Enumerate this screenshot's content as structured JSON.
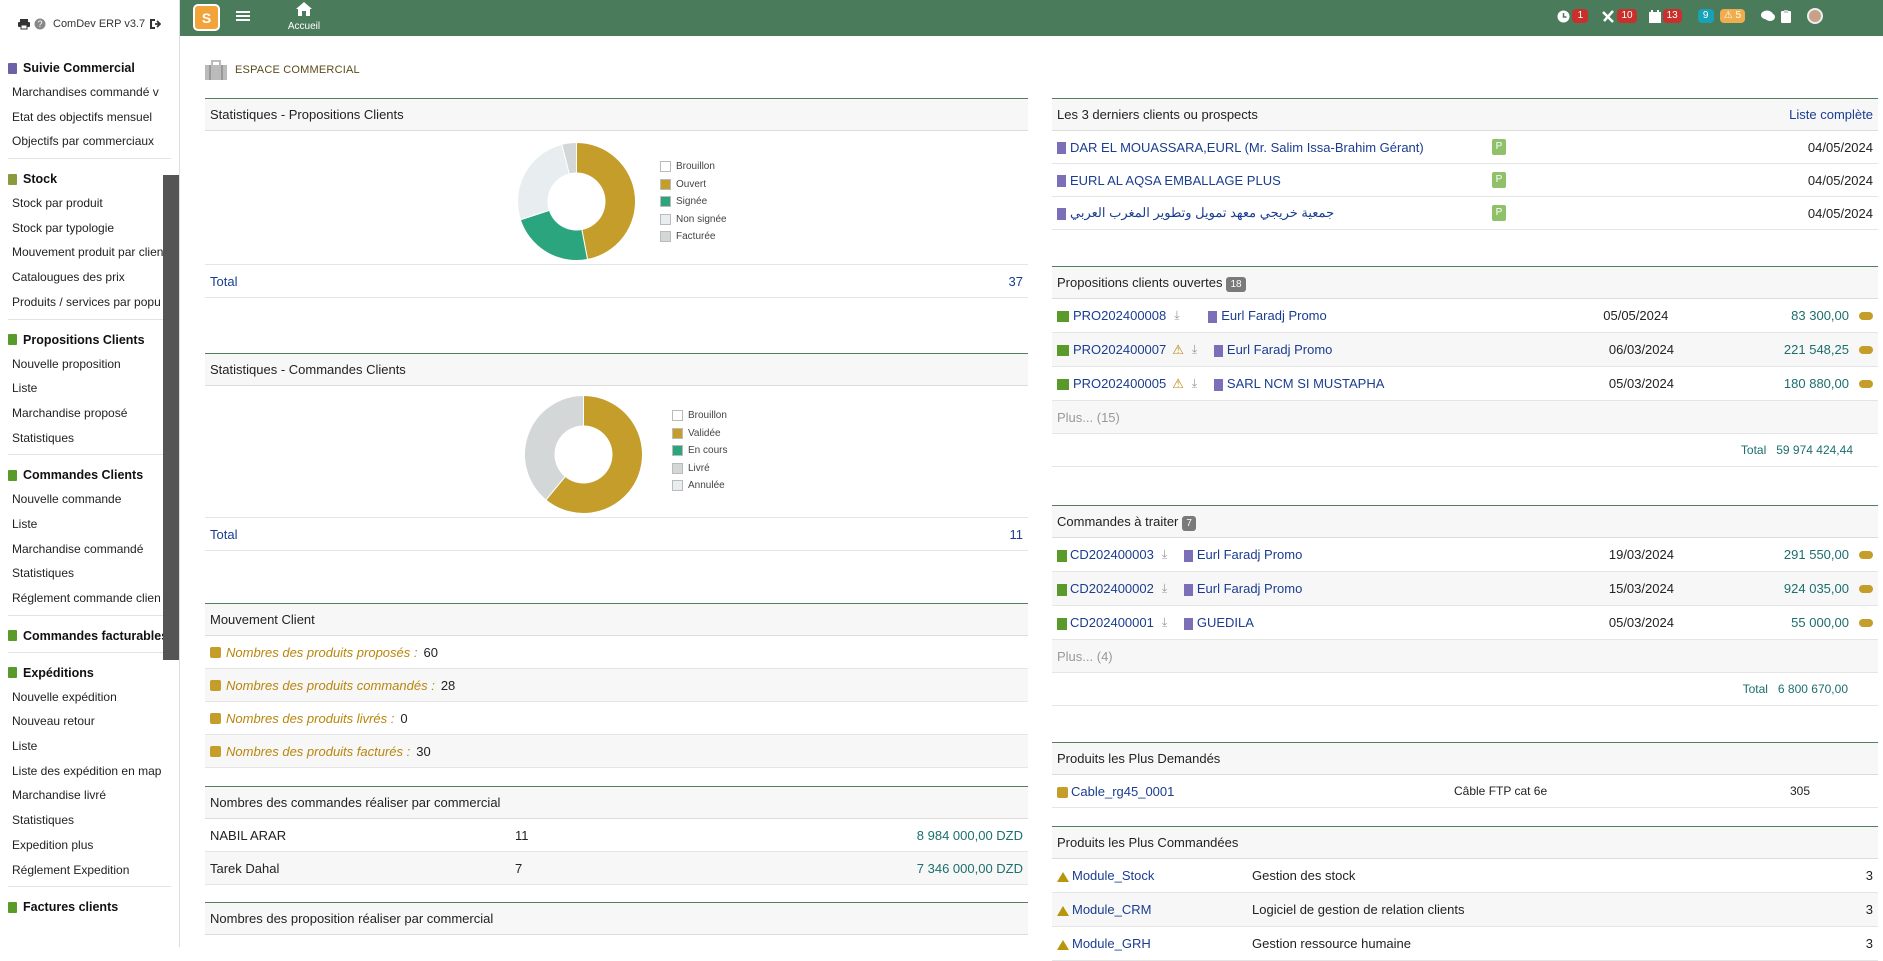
{
  "app": {
    "title": "ComDev ERP v3.7"
  },
  "topbar": {
    "home_label": "Accueil",
    "logo_text": "S",
    "badges": {
      "clock": "1",
      "tools": "10",
      "calendar": "13",
      "info": "9",
      "warn": "5"
    }
  },
  "sidebar": {
    "groups": [
      {
        "title": "Suivie Commercial",
        "items": [
          "Marchandises commandé v",
          "Etat des objectifs mensuel",
          "Objectifs par commerciaux"
        ]
      },
      {
        "title": "Stock",
        "items": [
          "Stock par produit",
          "Stock par typologie",
          "Mouvement produit par clien",
          "Catalougues des prix",
          "Produits / services par popu"
        ]
      },
      {
        "title": "Propositions Clients",
        "items": [
          "Nouvelle proposition",
          "Liste",
          "Marchandise proposé",
          "Statistiques"
        ]
      },
      {
        "title": "Commandes Clients",
        "items": [
          "Nouvelle commande",
          "Liste",
          "Marchandise commandé",
          "Statistiques",
          "Réglement commande clien"
        ]
      },
      {
        "title": "Commandes facturables",
        "items": []
      },
      {
        "title": "Expéditions",
        "items": [
          "Nouvelle expédition",
          "Nouveau retour",
          "Liste",
          "Liste des expédition en map",
          "Marchandise livré",
          "Statistiques",
          "Expedition plus",
          "Réglement Expedition"
        ]
      },
      {
        "title": "Factures clients",
        "items": []
      }
    ]
  },
  "page": {
    "title": "ESPACE COMMERCIAL"
  },
  "stats_props": {
    "title": "Statistiques - Propositions Clients",
    "legend": [
      "Brouillon",
      "Ouvert",
      "Signée",
      "Non signée",
      "Facturée"
    ],
    "total_label": "Total",
    "total": "37"
  },
  "stats_cmds": {
    "title": "Statistiques - Commandes Clients",
    "legend": [
      "Brouillon",
      "Validée",
      "En cours",
      "Livré",
      "Annulée"
    ],
    "total_label": "Total",
    "total": "11"
  },
  "mouvement": {
    "title": "Mouvement Client",
    "rows": [
      {
        "label": "Nombres des produits proposés :",
        "value": "60"
      },
      {
        "label": "Nombres des produits commandés :",
        "value": "28"
      },
      {
        "label": "Nombres des produits livrés :",
        "value": "0"
      },
      {
        "label": "Nombres des produits facturés :",
        "value": "30"
      }
    ]
  },
  "cmd_par_com": {
    "title": "Nombres des commandes réaliser par commercial",
    "rows": [
      {
        "name": "NABIL ARAR",
        "count": "11",
        "amount": "8 984 000,00 DZD"
      },
      {
        "name": "Tarek Dahal",
        "count": "7",
        "amount": "7 346 000,00 DZD"
      }
    ]
  },
  "prop_par_com": {
    "title": "Nombres des proposition réaliser par commercial"
  },
  "derniers_clients": {
    "title": "Les 3 derniers clients ou prospects",
    "link": "Liste complète",
    "rows": [
      {
        "name": "DAR EL MOUASSARA,EURL (Mr. Salim Issa-Brahim Gérant)",
        "badge": "P",
        "date": "04/05/2024"
      },
      {
        "name": "EURL AL AQSA EMBALLAGE PLUS",
        "badge": "P",
        "date": "04/05/2024"
      },
      {
        "name": "جمعية خريجي معهد تمويل وتطوير المغرب العربي",
        "badge": "P",
        "date": "04/05/2024"
      }
    ]
  },
  "props_ouvertes": {
    "title": "Propositions clients ouvertes",
    "count": "18",
    "rows": [
      {
        "ref": "PRO202400008",
        "client": "Eurl Faradj Promo",
        "date": "05/05/2024",
        "amount": "83 300,00"
      },
      {
        "ref": "PRO202400007",
        "client": "Eurl Faradj Promo",
        "date": "06/03/2024",
        "amount": "221 548,25"
      },
      {
        "ref": "PRO202400005",
        "client": "SARL NCM SI MUSTAPHA",
        "date": "05/03/2024",
        "amount": "180 880,00"
      }
    ],
    "more": "Plus... (15)",
    "total_label": "Total",
    "total": "59 974 424,44"
  },
  "cmds_traiter": {
    "title": "Commandes à traiter",
    "count": "7",
    "rows": [
      {
        "ref": "CD202400003",
        "client": "Eurl Faradj Promo",
        "date": "19/03/2024",
        "amount": "291 550,00"
      },
      {
        "ref": "CD202400002",
        "client": "Eurl Faradj Promo",
        "date": "15/03/2024",
        "amount": "924 035,00"
      },
      {
        "ref": "CD202400001",
        "client": "GUEDILA",
        "date": "05/03/2024",
        "amount": "55 000,00"
      }
    ],
    "more": "Plus... (4)",
    "total_label": "Total",
    "total": "6 800 670,00"
  },
  "plus_demandes": {
    "title": "Produits les Plus Demandés",
    "rows": [
      {
        "ref": "Cable_rg45_0001",
        "label": "Câble FTP cat 6e",
        "qty": "305"
      }
    ]
  },
  "plus_commandees": {
    "title": "Produits les Plus Commandées",
    "rows": [
      {
        "ref": "Module_Stock",
        "label": "Gestion des stock",
        "qty": "3"
      },
      {
        "ref": "Module_CRM",
        "label": "Logiciel de gestion de relation clients",
        "qty": "3"
      },
      {
        "ref": "Module_GRH",
        "label": "Gestion ressource humaine",
        "qty": "3"
      }
    ]
  },
  "colors": {
    "topbar": "#4a7c5c",
    "ouvert": "#c59d2a",
    "signee": "#2aa57e",
    "grey": "#d3d7d7"
  }
}
